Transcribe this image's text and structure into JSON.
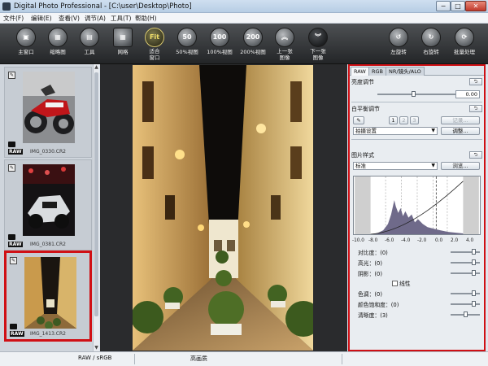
{
  "window": {
    "title": "Digital Photo Professional - [C:\\user\\Desktop\\Photo]",
    "min": "−",
    "max": "□",
    "close": "✕"
  },
  "menu": [
    "文件(F)",
    "编辑(E)",
    "查看(V)",
    "调节(A)",
    "工具(T)",
    "帮助(H)"
  ],
  "toolbar": {
    "items": [
      {
        "label": "主窗口",
        "icon": "main-window-icon",
        "glyph": "▣"
      },
      {
        "label": "缩略图",
        "icon": "thumbnail-icon",
        "glyph": "▦"
      },
      {
        "label": "工具",
        "icon": "tool-icon",
        "glyph": "▤"
      },
      {
        "label": "网格",
        "icon": "grid-icon",
        "glyph": "▦"
      },
      {
        "label": "适合\n窗口",
        "icon": "fit-window-icon",
        "glyph": "Fit"
      },
      {
        "label": "50%视图",
        "icon": "zoom-50-icon",
        "glyph": "50"
      },
      {
        "label": "100%视图",
        "icon": "zoom-100-icon",
        "glyph": "100"
      },
      {
        "label": "200%视图",
        "icon": "zoom-200-icon",
        "glyph": "200"
      },
      {
        "label": "上一张\n图像",
        "icon": "previous-image-icon",
        "glyph": "︽"
      },
      {
        "label": "下一张\n图像",
        "icon": "next-image-icon",
        "glyph": "︾"
      },
      {
        "label": "左旋转",
        "icon": "rotate-left-icon",
        "glyph": "↺"
      },
      {
        "label": "右旋转",
        "icon": "rotate-right-icon",
        "glyph": "↻"
      },
      {
        "label": "批量处理",
        "icon": "batch-process-icon",
        "glyph": "⟳"
      }
    ]
  },
  "thumbnails": [
    {
      "file": "IMG_0330.CR2",
      "raw": "RAW",
      "selected": false
    },
    {
      "file": "IMG_0381.CR2",
      "raw": "RAW",
      "selected": false
    },
    {
      "file": "IMG_1413.CR2",
      "raw": "RAW",
      "selected": true
    }
  ],
  "tool_palette": {
    "tabs": [
      "RAW",
      "RGB",
      "NR/镜头/ALO"
    ],
    "active_tab": "RAW",
    "brightness": {
      "title": "亮度调节",
      "value": "0.00"
    },
    "white_balance": {
      "title": "白平衡调节",
      "presets": [
        "1",
        "2",
        "3"
      ],
      "register": "记录...",
      "setting": "拍摄设置",
      "adjust": "调整..."
    },
    "picture_style": {
      "title": "图片样式",
      "style": "标准",
      "browse": "浏览..."
    },
    "histogram_ticks": [
      "-10.0",
      "-8.0",
      "-6.0",
      "-4.0",
      "-2.0",
      "0.0",
      "2.0",
      "4.0"
    ],
    "adjustments": [
      {
        "label": "对比度：",
        "value": "(0)",
        "level": 0.85
      },
      {
        "label": "高光：",
        "value": "(0)",
        "level": 0.85
      },
      {
        "label": "阴影：",
        "value": "(0)",
        "level": 0.85
      },
      {
        "label": "色调：",
        "value": "(0)",
        "level": 0.85
      },
      {
        "label": "颜色饱和度：",
        "value": "(0)",
        "level": 0.85
      },
      {
        "label": "清晰度：",
        "value": "(3)",
        "level": 0.5
      }
    ],
    "linear": "线性"
  },
  "status": {
    "mode": "RAW / sRGB",
    "quality": "高画质"
  }
}
